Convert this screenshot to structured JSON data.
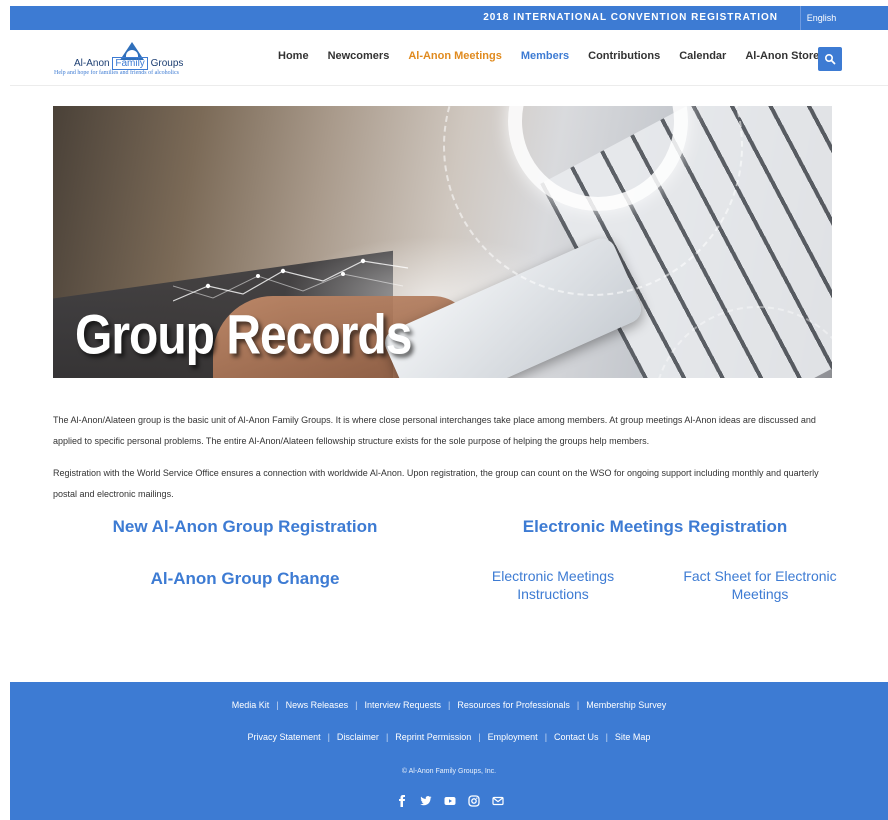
{
  "topbar": {
    "convention_link": "2018 INTERNATIONAL CONVENTION REGISTRATION",
    "language": "English"
  },
  "header": {
    "logo_name_part1": "Al-Anon",
    "logo_name_part2": "Family",
    "logo_name_part3": "Groups",
    "logo_tagline": "Help and hope for families and friends of alcoholics",
    "nav": [
      {
        "label": "Home"
      },
      {
        "label": "Newcomers"
      },
      {
        "label": "Al-Anon Meetings"
      },
      {
        "label": "Members"
      },
      {
        "label": "Contributions"
      },
      {
        "label": "Calendar"
      },
      {
        "label": "Al-Anon Store"
      }
    ]
  },
  "hero": {
    "title": "Group Records"
  },
  "main": {
    "paragraph1": "The Al-Anon/Alateen group is the basic unit of Al-Anon Family Groups. It is where close personal interchanges take place among members. At group meetings Al-Anon ideas are discussed and applied to specific personal problems. The entire Al-Anon/Alateen fellowship structure exists for the sole purpose of helping the groups help members.",
    "paragraph2": "Registration with the World Service Office ensures a connection with worldwide Al-Anon. Upon registration, the group can count on the WSO for ongoing support including monthly and quarterly postal and electronic mailings.",
    "links": {
      "new_group": "New Al-Anon Group Registration",
      "electronic_registration": "Electronic Meetings Registration",
      "group_change": "Al-Anon Group Change",
      "electronic_instructions": "Electronic Meetings Instructions",
      "fact_sheet": "Fact Sheet for Electronic Meetings"
    }
  },
  "footer": {
    "row1": [
      "Media Kit",
      "News Releases",
      "Interview Requests",
      "Resources for Professionals",
      "Membership Survey"
    ],
    "row2": [
      "Privacy Statement",
      "Disclaimer",
      "Reprint Permission",
      "Employment",
      "Contact Us",
      "Site Map"
    ],
    "separator": "|",
    "copyright": "© Al-Anon Family Groups, Inc.",
    "social": [
      "facebook-icon",
      "twitter-icon",
      "youtube-icon",
      "instagram-icon",
      "email-icon"
    ]
  },
  "colors": {
    "brand_blue": "#3d7bd3",
    "active_orange": "#e08a1e"
  }
}
